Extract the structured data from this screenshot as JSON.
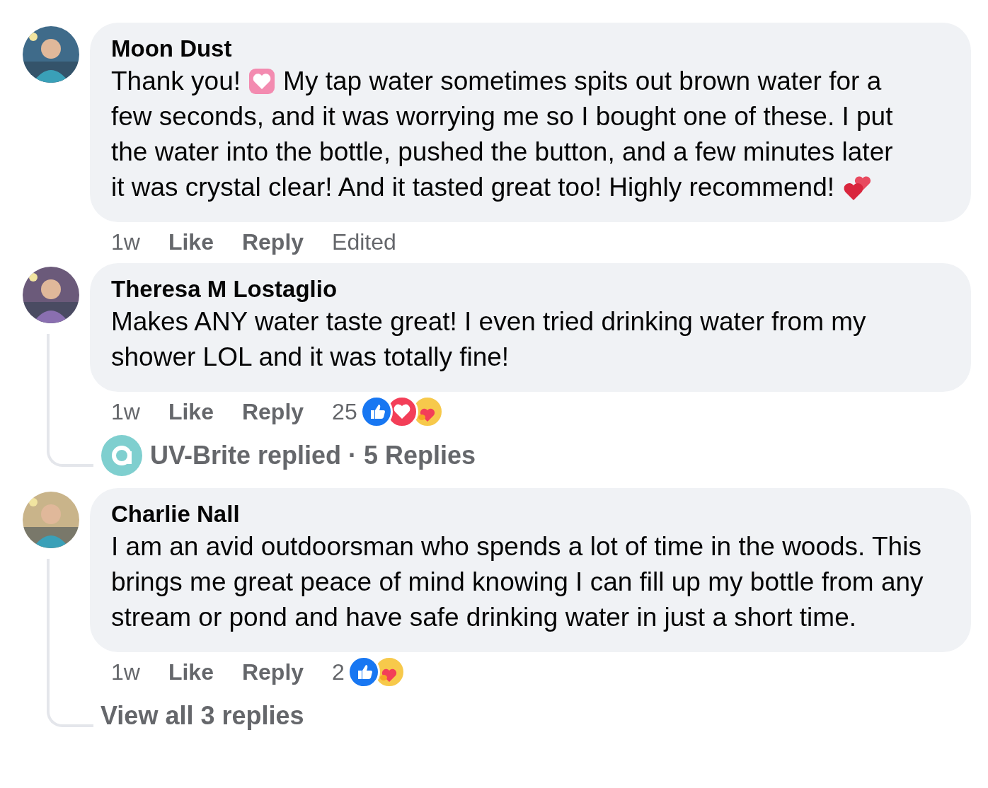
{
  "comments": [
    {
      "author": "Moon Dust",
      "avatar": {
        "kind": "picture"
      },
      "lines": [
        [
          {
            "kind": "text",
            "text": "Thank you!"
          },
          {
            "kind": "heart_emoji"
          },
          {
            "kind": "text",
            "text": "My tap water sometimes spits out brown water for a"
          }
        ],
        [
          {
            "kind": "text",
            "text": "few seconds, and it was worrying me so I bought one of these. I put"
          }
        ],
        [
          {
            "kind": "text",
            "text": "the water into the bottle, pushed the button, and a few minutes later"
          }
        ],
        [
          {
            "kind": "text",
            "text": "it was crystal clear! And it tasted great too! Highly recommend!"
          },
          {
            "kind": "hearts_emoji"
          }
        ]
      ],
      "time": "1w",
      "actions": [
        "Like",
        "Reply"
      ],
      "edited": "Edited"
    },
    {
      "author": "Theresa M Lostaglio",
      "avatar": {
        "kind": "picture"
      },
      "lines": [
        [
          {
            "kind": "text",
            "text": "Makes ANY water taste great! I even tried drinking water from my shower LOL and it was totally fine!"
          }
        ]
      ],
      "time": "1w",
      "actions": [
        "Like",
        "Reply"
      ],
      "reactions": {
        "count": "25",
        "icons": [
          {
            "kind": "like"
          },
          {
            "kind": "love"
          },
          {
            "kind": "care"
          }
        ]
      },
      "replies": {
        "kind": "page_reply",
        "text": "UV-Brite replied · 5 Replies"
      }
    },
    {
      "author": "Charlie Nall",
      "avatar": {
        "kind": "picture"
      },
      "lines": [
        [
          {
            "kind": "text",
            "text": "I am an avid outdoorsman who spends a lot of time in the woods. This brings me great peace of mind knowing I can fill up my bottle from any stream or pond and have safe drinking water in just a short time."
          }
        ]
      ],
      "time": "1w",
      "actions": [
        "Like",
        "Reply"
      ],
      "reactions": {
        "count": "2",
        "icons": [
          {
            "kind": "like"
          },
          {
            "kind": "care"
          }
        ]
      },
      "replies": {
        "kind": "view_all",
        "text": "View all 3 replies"
      }
    }
  ]
}
